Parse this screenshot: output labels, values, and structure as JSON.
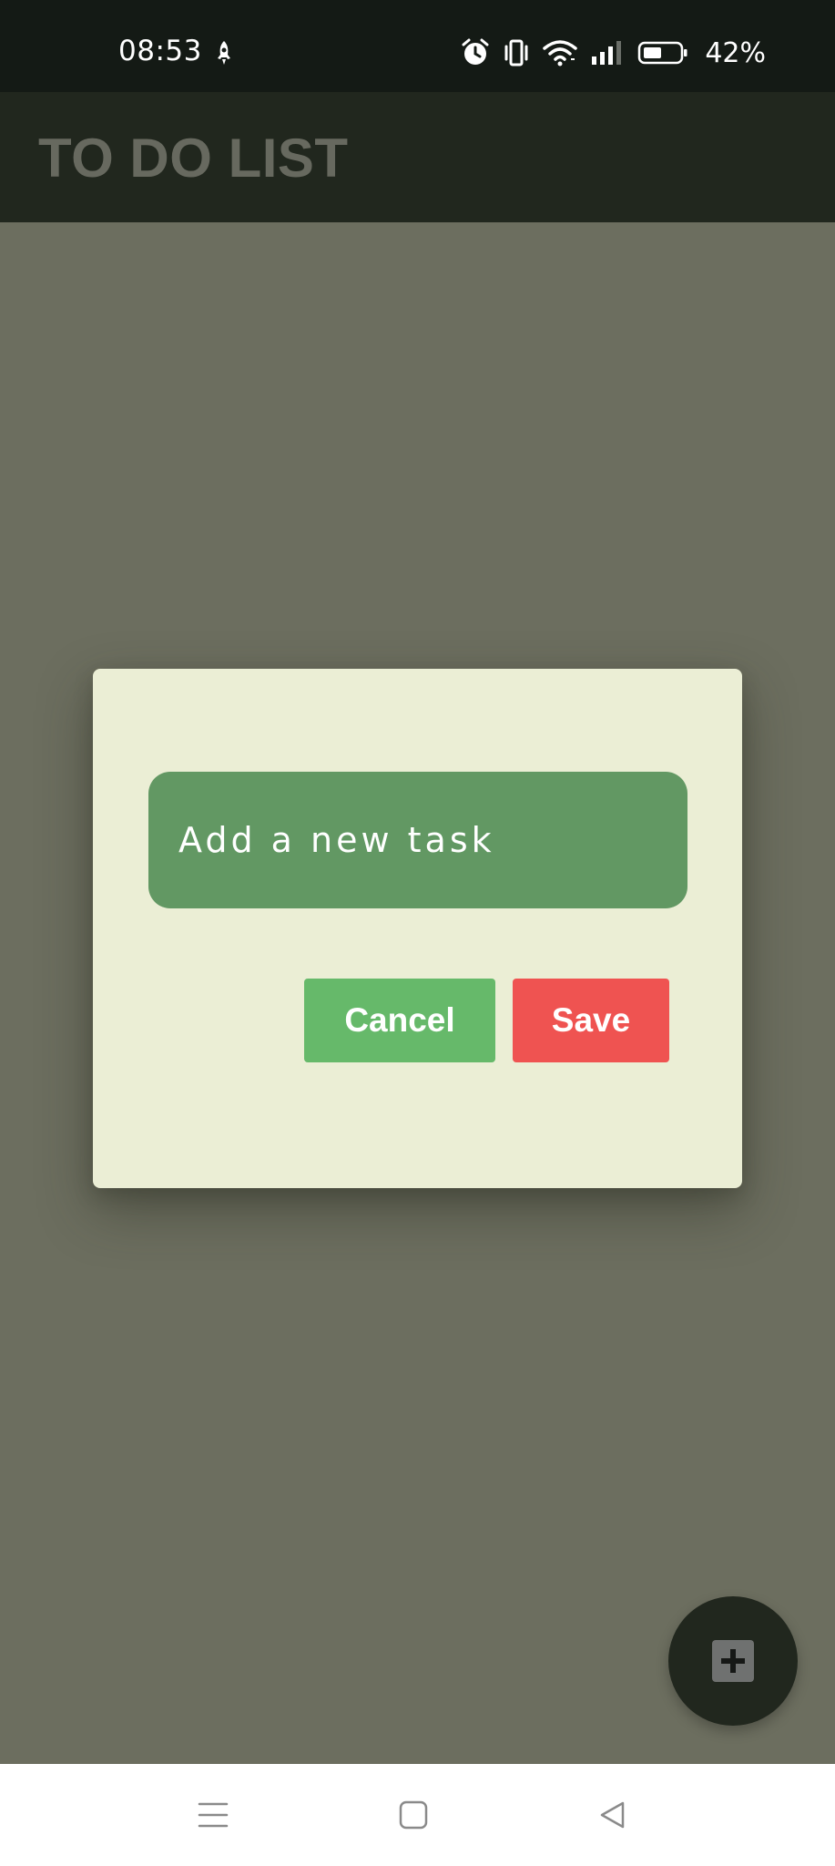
{
  "status_bar": {
    "time": "08:53",
    "battery_percent": "42%",
    "icons": [
      "rocket-icon",
      "alarm-icon",
      "vibrate-icon",
      "wifi-icon",
      "signal-icon",
      "battery-icon"
    ]
  },
  "app_bar": {
    "title": "TO DO LIST"
  },
  "dialog": {
    "input_placeholder": "Add a new task",
    "cancel_label": "Cancel",
    "save_label": "Save"
  },
  "fab": {
    "icon": "add-icon"
  },
  "nav_bar": {
    "icons": [
      "menu-icon",
      "home-icon",
      "back-icon"
    ]
  },
  "colors": {
    "scrim": "#6c6e5f",
    "app_bar": "#21271e",
    "dialog_bg": "#ebeed5",
    "input_bg": "#629863",
    "cancel": "#66b96a",
    "save": "#ef5351"
  }
}
